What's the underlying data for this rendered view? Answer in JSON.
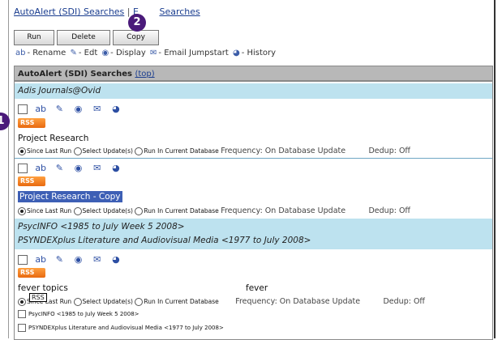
{
  "tabs": {
    "tab1": "AutoAlert (SDI) Searches",
    "sep": "|",
    "tab2_partial": "E",
    "tab2_rest": "Searches"
  },
  "buttons": {
    "run": "Run",
    "delete": "Delete",
    "copy": "Copy"
  },
  "legend": {
    "rename": "- Rename",
    "edit": "- Edt",
    "display": "- Display",
    "email": "- Email Jumpstart",
    "history": "- History"
  },
  "table": {
    "header": "AutoAlert (SDI) Searches",
    "header_link": "(top)",
    "groups": [
      {
        "name": "Adis Journals@Ovid"
      },
      {
        "name": "PsycINFO <1985 to July Week 5 2008>",
        "name2": "PSYNDEXplus Literature and Audiovisual Media <1977 to July 2008>"
      }
    ],
    "rss_label": "RSS",
    "searches": [
      {
        "name": "Project Research"
      },
      {
        "name": "Project Research - Copy"
      },
      {
        "name": "fever topics",
        "term": "fever"
      }
    ],
    "options": {
      "since_last_run": "Since Last Run",
      "select_updates": "Select Update(s)",
      "run_current_db": "Run In Current Database",
      "frequency": "Frequency: On Database Update",
      "dedup": "Dedup: Off"
    },
    "db_rows": [
      "PsycINFO <1985 to July Week 5 2008>",
      "PSYNDEXplus Literature and Audiovisual Media <1977 to July 2008>"
    ]
  },
  "tooltip": "RSS",
  "badges": {
    "one": "1",
    "two": "2"
  }
}
